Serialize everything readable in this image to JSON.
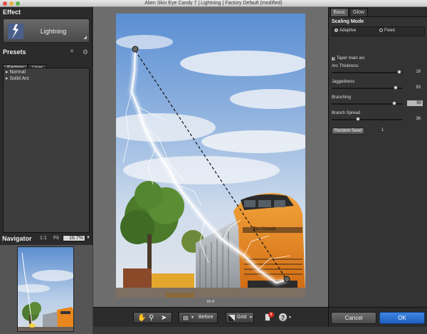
{
  "window": {
    "title": "Alien Skin Eye Candy 7 | Lightning | Factory Default (modified)"
  },
  "effect": {
    "heading": "Effect",
    "name": "Lightning"
  },
  "presets": {
    "heading": "Presets",
    "tabs": [
      {
        "label": "Factory",
        "active": true
      },
      {
        "label": "User",
        "active": false
      }
    ],
    "items": [
      {
        "label": "Normal"
      },
      {
        "label": "Solid Arc"
      }
    ]
  },
  "navigator": {
    "heading": "Navigator",
    "one_to_one": "1:1",
    "fit": "Fit",
    "zoom": "16.7%"
  },
  "canvas": {
    "filename": "88.tif"
  },
  "bottom_toolbar": {
    "before_label": "Before",
    "grid_label": "Grid",
    "badge_count": "8"
  },
  "right_panel": {
    "tabs": [
      {
        "label": "Basic",
        "active": true
      },
      {
        "label": "Glow",
        "active": false
      }
    ],
    "scaling_mode": {
      "label": "Scaling Mode",
      "options": [
        {
          "label": "Adaptive",
          "selected": true
        },
        {
          "label": "Fixed",
          "selected": false
        }
      ]
    },
    "taper": {
      "label": "Taper main arc",
      "checked": true
    },
    "sliders": [
      {
        "label": "Arc Thickness",
        "value": "18",
        "fraction": 0.92
      },
      {
        "label": "Jaggedness",
        "value": "93",
        "fraction": 0.93
      },
      {
        "label": "Branching",
        "value": "90",
        "fraction": 0.9,
        "editing": true
      },
      {
        "label": "Branch Spread",
        "value": "36",
        "fraction": 0.36
      }
    ],
    "random_seed": {
      "label": "Random Seed",
      "value": "1"
    },
    "cancel_label": "Cancel",
    "ok_label": "OK"
  }
}
